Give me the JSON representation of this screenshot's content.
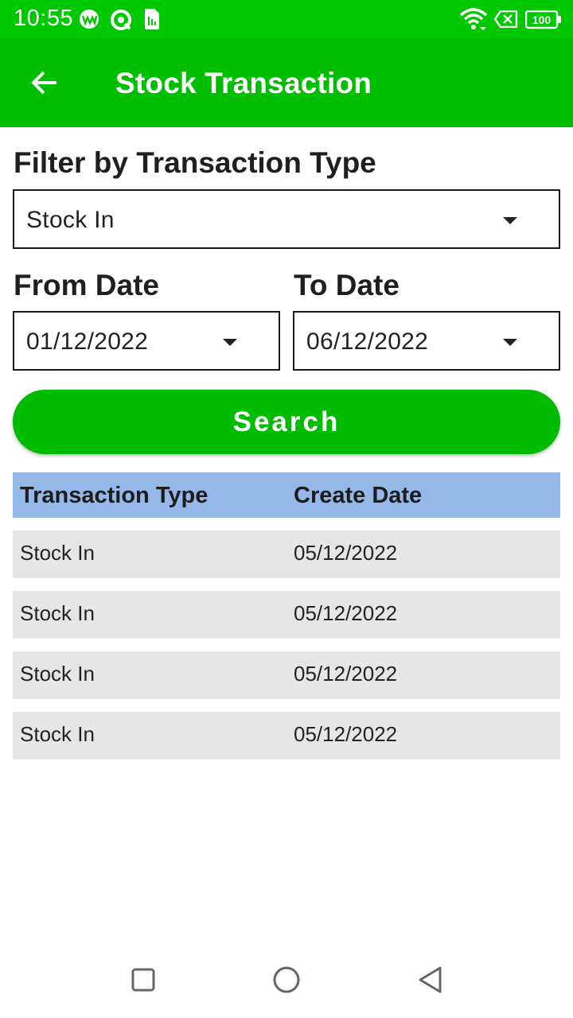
{
  "status_bar": {
    "time": "10:55",
    "battery": "100",
    "icons": [
      "app-notification-icon",
      "sync-icon",
      "sim-card-icon",
      "wifi-icon",
      "no-sim-icon",
      "battery-icon"
    ]
  },
  "app_bar": {
    "title": "Stock Transaction",
    "back_icon": "arrow-left-icon"
  },
  "filter": {
    "label": "Filter by Transaction Type",
    "selected": "Stock In"
  },
  "from_date": {
    "label": "From Date",
    "value": "01/12/2022"
  },
  "to_date": {
    "label": "To Date",
    "value": "06/12/2022"
  },
  "search_button": {
    "label": "Search"
  },
  "table": {
    "columns": [
      "Transaction Type",
      "Create Date"
    ],
    "rows": [
      {
        "type": "Stock In",
        "date": "05/12/2022"
      },
      {
        "type": "Stock In",
        "date": "05/12/2022"
      },
      {
        "type": "Stock In",
        "date": "05/12/2022"
      },
      {
        "type": "Stock In",
        "date": "05/12/2022"
      }
    ]
  },
  "colors": {
    "primary": "#00bf00",
    "status_bar": "#00c800",
    "table_header": "#95b8e8",
    "row_background": "#e6e6e6"
  },
  "nav_bar": {
    "icons": [
      "recents-square-icon",
      "home-circle-icon",
      "back-triangle-icon"
    ]
  }
}
